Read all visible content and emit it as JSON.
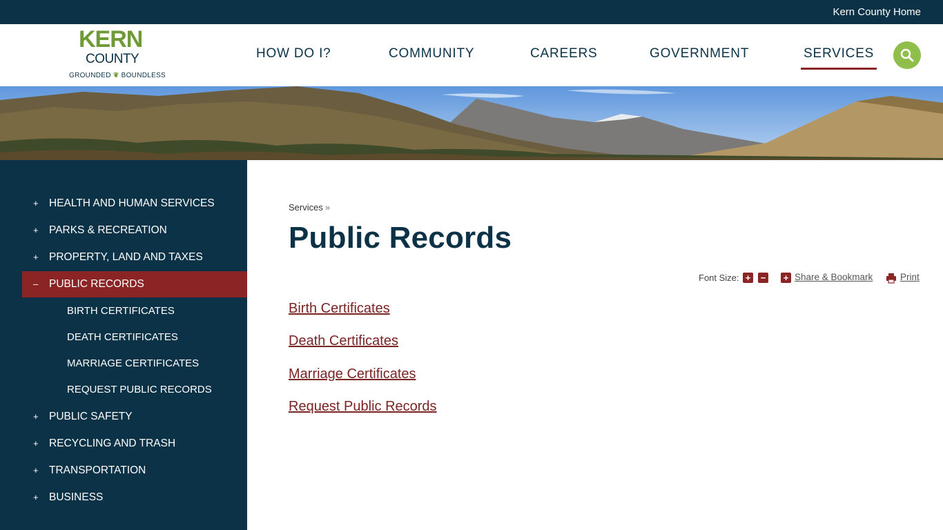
{
  "topbar": {
    "home_link": "Kern County Home"
  },
  "logo": {
    "line1": "KERN",
    "line2": "COUNTY",
    "tag_left": "GROUNDED",
    "tag_right": "BOUNDLESS"
  },
  "nav": {
    "items": [
      "HOW DO I?",
      "COMMUNITY",
      "CAREERS",
      "GOVERNMENT",
      "SERVICES"
    ],
    "active": "SERVICES"
  },
  "sidebar": {
    "items": [
      {
        "label": "HEALTH AND HUMAN SERVICES",
        "symbol": "+"
      },
      {
        "label": "PARKS & RECREATION",
        "symbol": "+"
      },
      {
        "label": "PROPERTY, LAND AND TAXES",
        "symbol": "+"
      },
      {
        "label": "PUBLIC RECORDS",
        "symbol": "–",
        "active": true
      },
      {
        "label": "PUBLIC SAFETY",
        "symbol": "+"
      },
      {
        "label": "RECYCLING AND TRASH",
        "symbol": "+"
      },
      {
        "label": "TRANSPORTATION",
        "symbol": "+"
      },
      {
        "label": "BUSINESS",
        "symbol": "+"
      }
    ],
    "subitems": [
      "BIRTH CERTIFICATES",
      "DEATH CERTIFICATES",
      "MARRIAGE CERTIFICATES",
      "REQUEST PUBLIC RECORDS"
    ]
  },
  "main": {
    "breadcrumb": {
      "label": "Services",
      "sep": "»"
    },
    "title": "Public Records",
    "tools": {
      "font_size_label": "Font Size:",
      "increase": "+",
      "decrease": "−",
      "share_label": "Share & Bookmark",
      "print_label": "Print"
    },
    "links": [
      "Birth Certificates",
      "Death Certificates",
      "Marriage Certificates",
      "Request Public Records"
    ]
  },
  "colors": {
    "navy": "#0b3247",
    "accent_red": "#8b2525",
    "logo_green": "#6e9a37",
    "search_green": "#8fbf4a"
  },
  "icons": [
    "search-icon",
    "plus-icon",
    "minus-icon",
    "share-icon",
    "print-icon"
  ]
}
